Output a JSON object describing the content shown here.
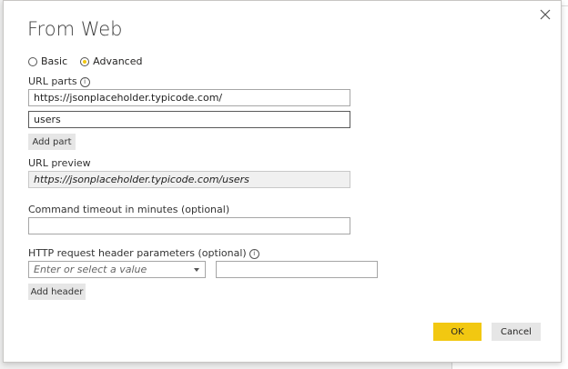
{
  "dialog": {
    "title": "From Web",
    "close_label": "×"
  },
  "mode": {
    "options": [
      {
        "label": "Basic",
        "selected": false
      },
      {
        "label": "Advanced",
        "selected": true
      }
    ]
  },
  "url_parts": {
    "label": "URL parts",
    "parts": [
      "https://jsonplaceholder.typicode.com/",
      "users"
    ],
    "add_part_label": "Add part"
  },
  "url_preview": {
    "label": "URL preview",
    "value": "https://jsonplaceholder.typicode.com/users"
  },
  "timeout": {
    "label": "Command timeout in minutes (optional)",
    "value": ""
  },
  "headers": {
    "label": "HTTP request header parameters (optional)",
    "name_placeholder": "Enter or select a value",
    "value": "",
    "add_header_label": "Add header"
  },
  "footer": {
    "ok_label": "OK",
    "cancel_label": "Cancel"
  },
  "colors": {
    "accent": "#f2c811",
    "button_gray": "#e6e6e6"
  }
}
